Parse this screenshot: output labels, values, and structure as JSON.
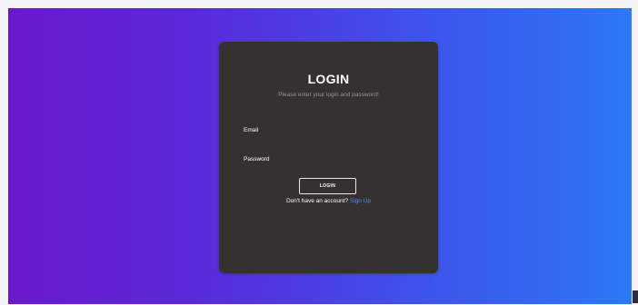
{
  "login": {
    "title": "LOGIN",
    "subtitle": "Please enter your login and password!",
    "email_label": "Email",
    "email_value": "",
    "password_label": "Password",
    "password_value": "",
    "button_label": "LOGIN",
    "signup_prompt": "Don't have an account?",
    "signup_link": "Sign Up"
  },
  "colors": {
    "gradient_start": "#6b18cc",
    "gradient_end": "#2c78f6",
    "card_background": "#353131",
    "link": "#4f8ff5"
  }
}
